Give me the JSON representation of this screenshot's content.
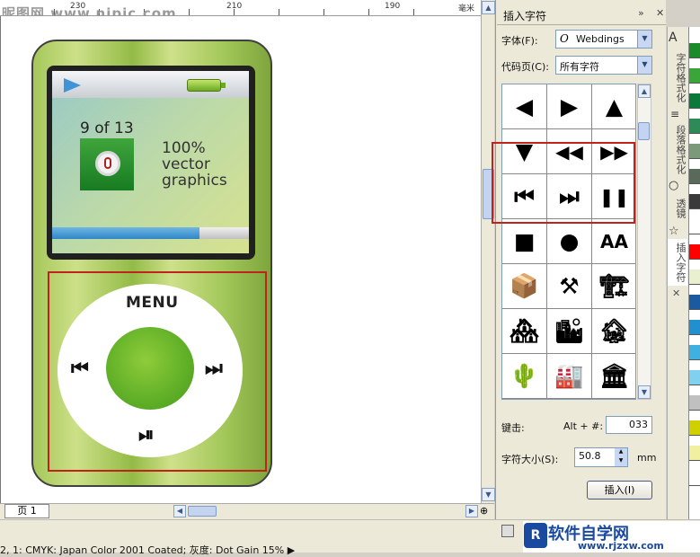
{
  "watermark": "昵图网 www.nipic.com",
  "ruler": {
    "labels": [
      "230",
      "210",
      "190"
    ],
    "unit": "毫米"
  },
  "ipod": {
    "track_count": "9 of 13",
    "screen_text": "100%\nvector\ngraphics",
    "progress": 0.75,
    "menu_label": "MENU",
    "prev_icon": "⏮",
    "next_icon": "⏭",
    "play_pause_icon": "⏯"
  },
  "canvas": {
    "page_tab": "页 1"
  },
  "docker": {
    "title": "插入字符",
    "font_label": "字体(F):",
    "font_value": "Webdings",
    "font_icon": "O",
    "codepage_label": "代码页(C):",
    "codepage_value": "所有字符",
    "glyphs": [
      "◀",
      "▶",
      "▲",
      "▼",
      "◀◀",
      "▶▶",
      "⏮",
      "⏭",
      "❚❚",
      "■",
      "●",
      "AA",
      "📦",
      "⚒",
      "🏗",
      "🏘",
      "🏙",
      "🏚",
      "🌵",
      "🏭",
      "🏛"
    ],
    "keystroke_label": "键击:",
    "keystroke_alt": "Alt + #:",
    "keystroke_value": "033",
    "size_label": "字符大小(S):",
    "size_value": "50.8",
    "size_unit": "mm",
    "insert_button": "插入(I)"
  },
  "side_tabs": [
    "字符格式化",
    "段落格式化",
    "透镜",
    "插入字符"
  ],
  "status": {
    "text": "2, 1: CMYK: Japan Color 2001 Coated; 灰度: Dot Gain 15% ▶"
  },
  "logo": {
    "name": "软件自学网",
    "url": "www.rjzxw.com"
  },
  "palette_colors": [
    "#1a8a2a",
    "#3aa63a",
    "#0a7a3a",
    "#2e8b57",
    "#7a9a7a",
    "#5a6a5a",
    "#3a3a3a",
    "#ffffff",
    "#ff0000",
    "#e8f0d0",
    "#1a5aa0",
    "#2090d0",
    "#40b0e0",
    "#80d0f0",
    "#c0c0c0",
    "#d0d000",
    "#f0f0a0",
    "#ffffff"
  ]
}
